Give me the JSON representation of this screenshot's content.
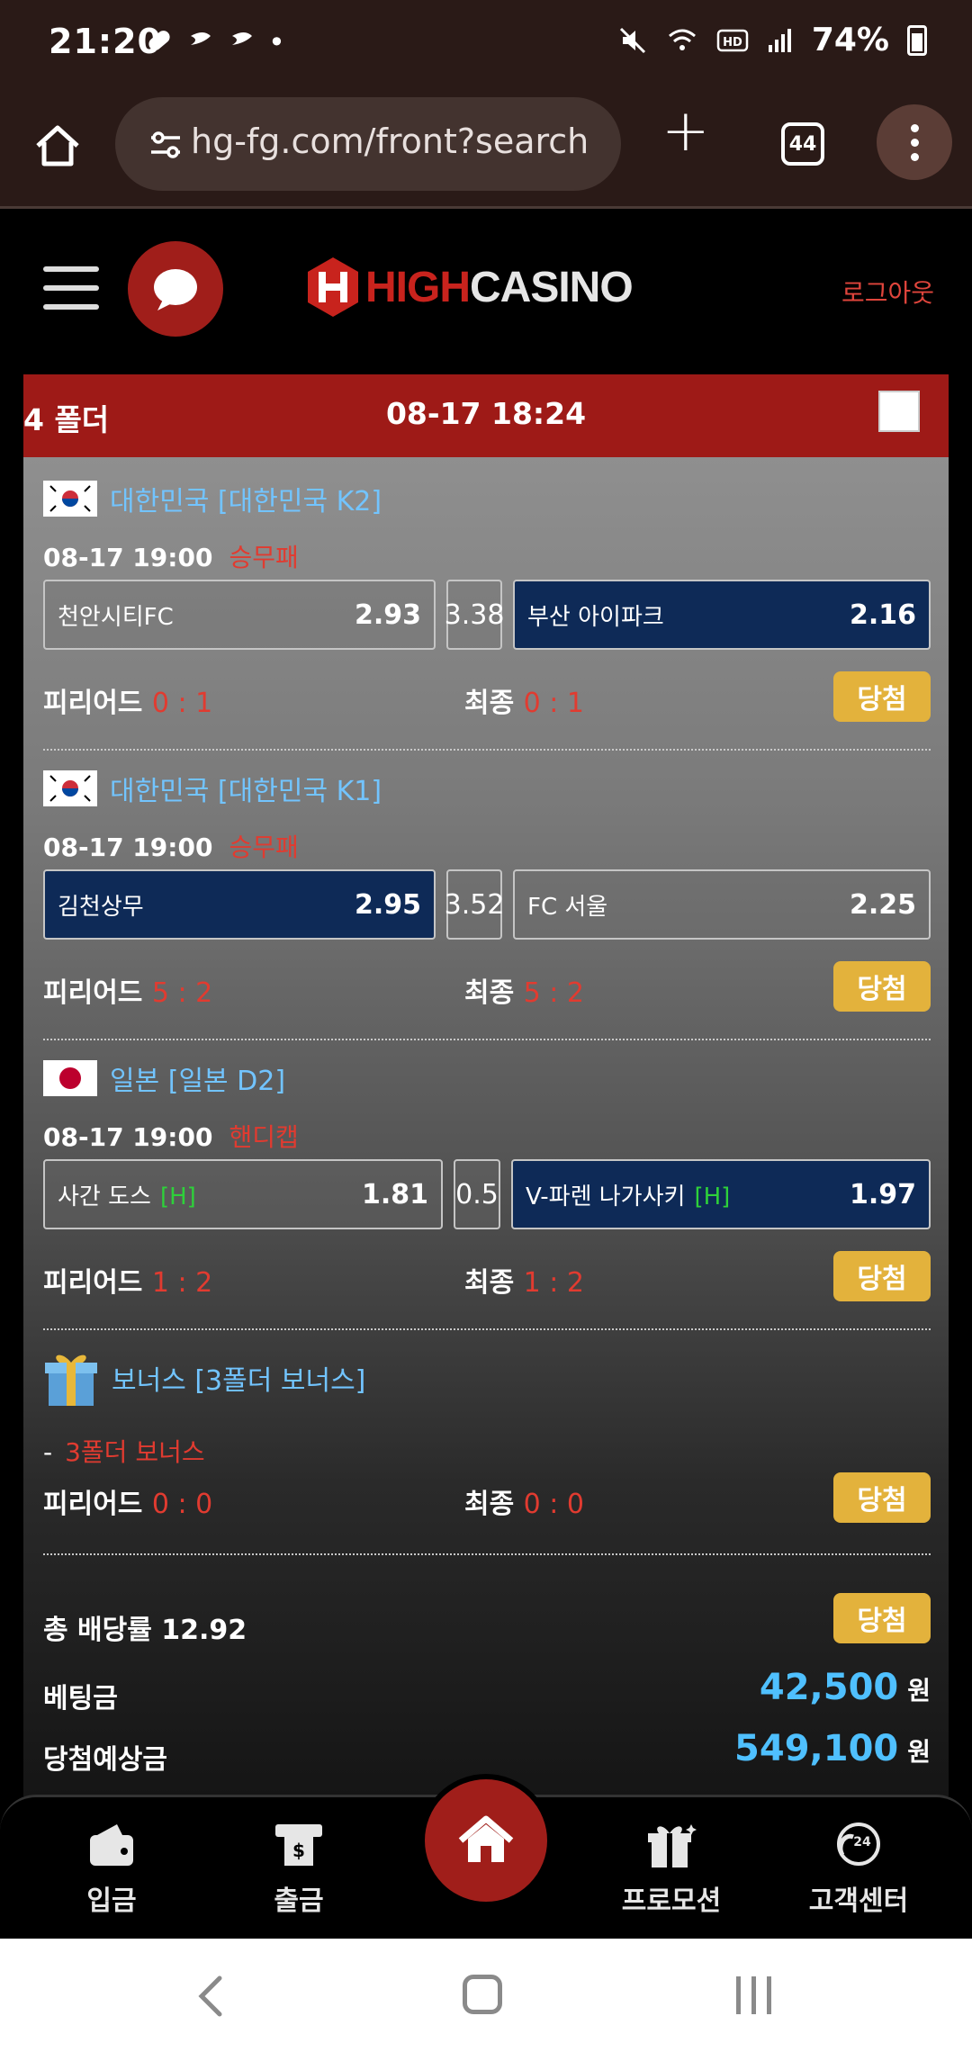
{
  "status_bar": {
    "time": "21:20",
    "battery": "74%",
    "dot": "•"
  },
  "browser": {
    "url": "hg-fg.com/front?search",
    "tab_count": "44"
  },
  "header": {
    "logo_high": "HIGH",
    "logo_casino": "CASINO",
    "logout": "로그아웃"
  },
  "bet": {
    "folder_label": "4 폴더",
    "datetime": "08-17 18:24",
    "result_button": "당첨",
    "period_label": "피리어드",
    "final_label": "최종",
    "matches": [
      {
        "league": "대한민국 [대한민국 K2]",
        "time": "08-17 19:00",
        "type": "승무패",
        "home": "천안시티FC",
        "home_odds": "2.93",
        "mid": "3.38",
        "away": "부산 아이파크",
        "away_odds": "2.16",
        "period_score": "0 : 1",
        "final_score": "0 : 1"
      },
      {
        "league": "대한민국 [대한민국 K1]",
        "time": "08-17 19:00",
        "type": "승무패",
        "home": "김천상무",
        "home_odds": "2.95",
        "mid": "3.52",
        "away": "FC 서울",
        "away_odds": "2.25",
        "period_score": "5 : 2",
        "final_score": "5 : 2"
      },
      {
        "league": "일본 [일본 D2]",
        "time": "08-17 19:00",
        "type": "핸디캡",
        "home": "사간 도스",
        "home_odds": "1.81",
        "mid": "0.5",
        "away": "V-파렌 나가사키",
        "away_odds": "1.97",
        "handicap_mark": "[H]",
        "period_score": "1 : 2",
        "final_score": "1 : 2"
      }
    ],
    "bonus": {
      "title": "보너스 [3폴더 보너스]",
      "dash": "-",
      "name": "3폴더 보너스",
      "period_score": "0 : 0",
      "final_score": "0 : 0"
    },
    "total_odds": "총 배당률 12.92",
    "stake_label": "베팅금",
    "stake_value": "42,500",
    "expected_label": "당첨예상금",
    "expected_value": "549,100",
    "currency": "원"
  },
  "bottom_nav": {
    "deposit": "입금",
    "withdraw": "출금",
    "promotion": "프로모션",
    "support": "고객센터"
  },
  "colors": {
    "brand_red": "#a01e1a",
    "gold": "#e3b23c",
    "link_blue": "#72c4ff",
    "selected": "#0e2a57"
  }
}
